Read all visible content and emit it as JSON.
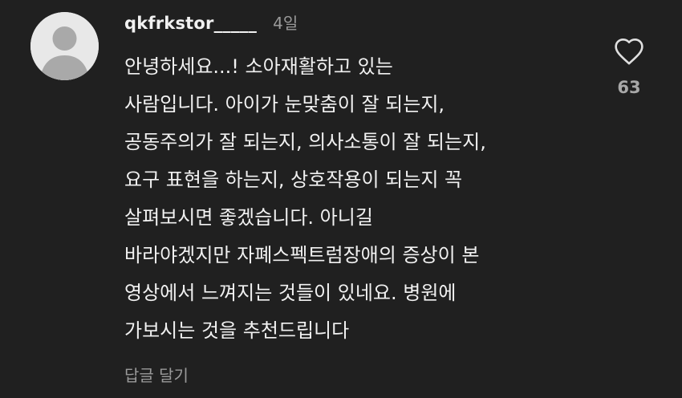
{
  "comment": {
    "username": "qkfrkstor_____",
    "timestamp": "4일",
    "body_lines": [
      "안녕하세요...! 소아재활하고 있는",
      "사람입니다. 아이가 눈맞춤이 잘 되는지,",
      "공동주의가 잘 되는지, 의사소통이 잘 되는지,",
      "요구 표현을 하는지, 상호작용이 되는지 꼭",
      "살펴보시면 좋겠습니다. 아니길",
      "바라야겠지만 자폐스펙트럼장애의 증상이 본",
      "영상에서 느껴지는 것들이 있네요. 병원에",
      "가보시는 것을 추천드립니다"
    ],
    "reply_label": "답글 달기",
    "like_count": "63",
    "icons": {
      "avatar": "default-avatar-icon",
      "like": "heart-outline-icon"
    }
  },
  "colors": {
    "background": "#202020",
    "text": "#f1f1f1",
    "secondary_text": "#9a9a9a",
    "avatar_bg": "#e8e8e8",
    "avatar_silhouette": "#a9a9a9"
  }
}
